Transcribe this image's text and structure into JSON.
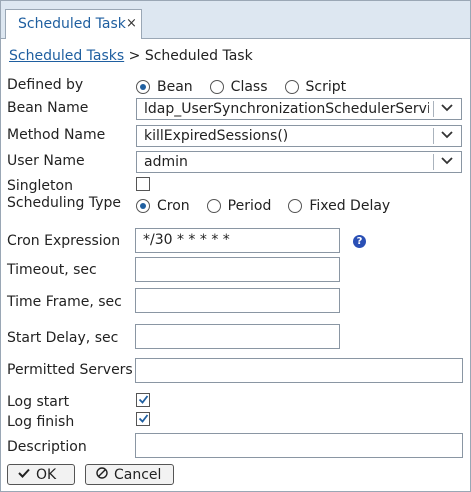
{
  "tab": {
    "title": "Scheduled Task",
    "close": "×"
  },
  "breadcrumb": {
    "link": "Scheduled Tasks",
    "separator": ">",
    "current": "Scheduled Task"
  },
  "labels": {
    "defined_by": "Defined by",
    "bean_name": "Bean Name",
    "method_name": "Method Name",
    "user_name": "User Name",
    "singleton": "Singleton",
    "scheduling_type": "Scheduling Type",
    "cron_expression": "Cron Expression",
    "timeout": "Timeout, sec",
    "time_frame": "Time Frame, sec",
    "start_delay": "Start Delay, sec",
    "permitted_servers": "Permitted Servers",
    "log_start": "Log start",
    "log_finish": "Log finish",
    "description": "Description"
  },
  "defined_by": {
    "options": [
      "Bean",
      "Class",
      "Script"
    ],
    "selected": "Bean"
  },
  "bean_name": {
    "value": "ldap_UserSynchronizationSchedulerService"
  },
  "method_name": {
    "value": "killExpiredSessions()"
  },
  "user_name": {
    "value": "admin"
  },
  "singleton": {
    "checked": false
  },
  "scheduling_type": {
    "options": [
      "Cron",
      "Period",
      "Fixed Delay"
    ],
    "selected": "Cron"
  },
  "cron_expression": {
    "value": "*/30 * * * * *"
  },
  "timeout": {
    "value": ""
  },
  "time_frame": {
    "value": ""
  },
  "start_delay": {
    "value": ""
  },
  "permitted_servers": {
    "value": ""
  },
  "log_start": {
    "checked": true
  },
  "log_finish": {
    "checked": true
  },
  "description": {
    "value": ""
  },
  "buttons": {
    "ok": "OK",
    "cancel": "Cancel",
    "ok_icon": "checkmark-icon",
    "cancel_icon": "cancel-icon"
  },
  "help_icon": {
    "glyph": "?"
  },
  "colors": {
    "accent": "#1f5fa0",
    "tabbar": "#dde7f1",
    "help": "#2a4fb5"
  }
}
